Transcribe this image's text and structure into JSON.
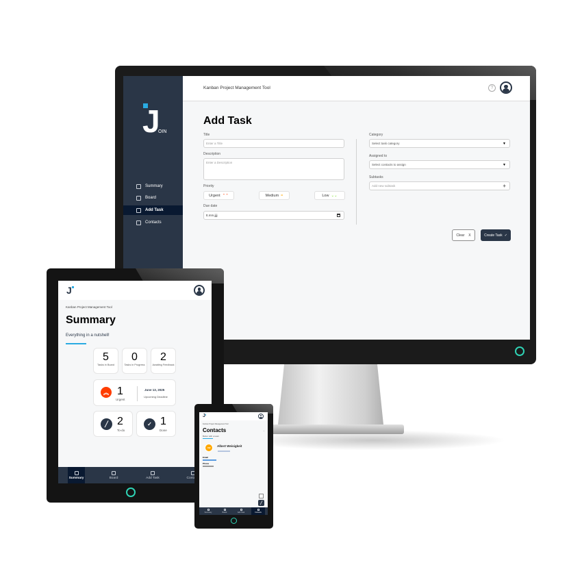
{
  "colors": {
    "sidebar": "#2a3647",
    "active": "#091931",
    "accent": "#29abe2",
    "urgent": "#ff3d00",
    "medium": "#ffa800",
    "low": "#7ae229",
    "power": "#2fd3b5"
  },
  "desktop": {
    "logo_suffix": "OIN",
    "header_title": "Kanban Project Management Tool",
    "help_glyph": "?",
    "nav": [
      {
        "label": "Summary",
        "icon": "summary-icon"
      },
      {
        "label": "Board",
        "icon": "board-icon"
      },
      {
        "label": "Add Task",
        "icon": "add-task-icon"
      },
      {
        "label": "Contacts",
        "icon": "contacts-icon"
      }
    ],
    "page_title": "Add Task",
    "form": {
      "title_label": "Title",
      "title_placeholder": "Enter a Title",
      "description_label": "Description",
      "description_placeholder": "Enter a Description",
      "priority_label": "Priority",
      "priorities": [
        {
          "label": "Urgent",
          "glyph": "⌃⌃"
        },
        {
          "label": "Medium",
          "glyph": "="
        },
        {
          "label": "Low",
          "glyph": "⌄⌄"
        }
      ],
      "due_label": "Due date",
      "due_placeholder": "tt.mm.jjjj",
      "category_label": "Category",
      "category_placeholder": "Select task category",
      "assigned_label": "Assigned to",
      "assigned_placeholder": "Select contacts to assign",
      "subtasks_label": "Subtasks",
      "subtasks_placeholder": "Add new subtask",
      "clear_label": "Clear",
      "clear_glyph": "X",
      "create_label": "Create Task",
      "create_glyph": "✓"
    }
  },
  "tablet": {
    "header_title": "Kanban Project Management Tool",
    "page_title": "Summary",
    "subtitle": "Everything in a nutshell!",
    "tiles": [
      {
        "count": "5",
        "label": "Tasks in Board"
      },
      {
        "count": "0",
        "label": "Tasks in Progress"
      },
      {
        "count": "2",
        "label": "Awaiting Feedback"
      }
    ],
    "urgent": {
      "count": "1",
      "label": "Urgent",
      "date": "June 13, 2025",
      "date_label": "Upcoming Deadline"
    },
    "todo": {
      "count": "2",
      "label": "To-do"
    },
    "done": {
      "count": "1",
      "label": "Done"
    },
    "nav": [
      "Summary",
      "Board",
      "Add Task",
      "Contacts"
    ]
  },
  "phone": {
    "header_title": "Kanban Project Management Tool",
    "page_title": "Contacts",
    "subtitle": "Better with a team",
    "contact": {
      "initials": "AW",
      "name": "Albert Weisigkeit",
      "email_label": "Email",
      "phone_label": "Phone"
    },
    "nav": [
      "Summary",
      "Board",
      "Add Task",
      "Contacts"
    ]
  }
}
